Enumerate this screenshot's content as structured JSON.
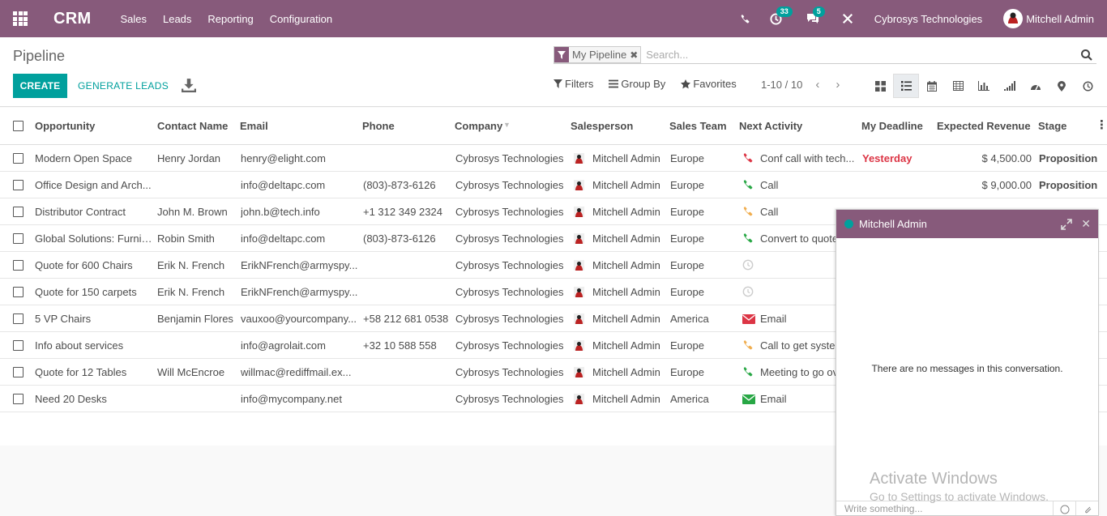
{
  "navbar": {
    "app_name": "CRM",
    "menu": [
      "Sales",
      "Leads",
      "Reporting",
      "Configuration"
    ],
    "activity_count": "33",
    "message_count": "5",
    "company": "Cybrosys Technologies",
    "user": "Mitchell Admin",
    "bg_color": "#875a7b"
  },
  "control_panel": {
    "breadcrumb": "Pipeline",
    "facet": "My Pipeline",
    "search_placeholder": "Search...",
    "create_label": "CREATE",
    "generate_label": "GENERATE LEADS",
    "filters_label": "Filters",
    "groupby_label": "Group By",
    "favorites_label": "Favorites",
    "pager": "1-10 / 10"
  },
  "table": {
    "headers": {
      "opportunity": "Opportunity",
      "contact": "Contact Name",
      "email": "Email",
      "phone": "Phone",
      "company": "Company",
      "salesperson": "Salesperson",
      "team": "Sales Team",
      "activity": "Next Activity",
      "deadline": "My Deadline",
      "revenue": "Expected Revenue",
      "stage": "Stage"
    },
    "rows": [
      {
        "opportunity": "Modern Open Space",
        "contact": "Henry Jordan",
        "email": "henry@elight.com",
        "phone": "",
        "company": "Cybrosys Technologies",
        "salesperson": "Mitchell Admin",
        "team": "Europe",
        "activity": "Conf call with tech...",
        "activity_icon": "phone-red",
        "deadline": "Yesterday",
        "revenue": "$ 4,500.00",
        "stage": "Proposition"
      },
      {
        "opportunity": "Office Design and Arch...",
        "contact": "",
        "email": "info@deltapc.com",
        "phone": "(803)-873-6126",
        "company": "Cybrosys Technologies",
        "salesperson": "Mitchell Admin",
        "team": "Europe",
        "activity": "Call",
        "activity_icon": "phone-green",
        "deadline": "",
        "revenue": "$ 9,000.00",
        "stage": "Proposition"
      },
      {
        "opportunity": "Distributor Contract",
        "contact": "John M. Brown",
        "email": "john.b@tech.info",
        "phone": "+1 312 349 2324",
        "company": "Cybrosys Technologies",
        "salesperson": "Mitchell Admin",
        "team": "Europe",
        "activity": "Call",
        "activity_icon": "phone-orange",
        "deadline": "",
        "revenue": "",
        "stage": ""
      },
      {
        "opportunity": "Global Solutions: Furnit...",
        "contact": "Robin Smith",
        "email": "info@deltapc.com",
        "phone": "(803)-873-6126",
        "company": "Cybrosys Technologies",
        "salesperson": "Mitchell Admin",
        "team": "Europe",
        "activity": "Convert to quote",
        "activity_icon": "phone-green",
        "deadline": "",
        "revenue": "",
        "stage": ""
      },
      {
        "opportunity": "Quote for 600 Chairs",
        "contact": "Erik N. French",
        "email": "ErikNFrench@armyspy...",
        "phone": "",
        "company": "Cybrosys Technologies",
        "salesperson": "Mitchell Admin",
        "team": "Europe",
        "activity": "",
        "activity_icon": "clock-gray",
        "deadline": "",
        "revenue": "",
        "stage": ""
      },
      {
        "opportunity": "Quote for 150 carpets",
        "contact": "Erik N. French",
        "email": "ErikNFrench@armyspy...",
        "phone": "",
        "company": "Cybrosys Technologies",
        "salesperson": "Mitchell Admin",
        "team": "Europe",
        "activity": "",
        "activity_icon": "clock-gray",
        "deadline": "",
        "revenue": "",
        "stage": ""
      },
      {
        "opportunity": "5 VP Chairs",
        "contact": "Benjamin Flores",
        "email": "vauxoo@yourcompany...",
        "phone": "+58 212 681 0538",
        "company": "Cybrosys Technologies",
        "salesperson": "Mitchell Admin",
        "team": "America",
        "activity": "Email",
        "activity_icon": "email-red",
        "deadline": "",
        "revenue": "",
        "stage": ""
      },
      {
        "opportunity": "Info about services",
        "contact": "",
        "email": "info@agrolait.com",
        "phone": "+32 10 588 558",
        "company": "Cybrosys Technologies",
        "salesperson": "Mitchell Admin",
        "team": "Europe",
        "activity": "Call to get system",
        "activity_icon": "phone-orange",
        "deadline": "",
        "revenue": "",
        "stage": ""
      },
      {
        "opportunity": "Quote for 12 Tables",
        "contact": "Will McEncroe",
        "email": "willmac@rediffmail.ex...",
        "phone": "",
        "company": "Cybrosys Technologies",
        "salesperson": "Mitchell Admin",
        "team": "Europe",
        "activity": "Meeting to go over",
        "activity_icon": "phone-green",
        "deadline": "",
        "revenue": "",
        "stage": ""
      },
      {
        "opportunity": "Need 20 Desks",
        "contact": "",
        "email": "info@mycompany.net",
        "phone": "",
        "company": "Cybrosys Technologies",
        "salesperson": "Mitchell Admin",
        "team": "America",
        "activity": "Email",
        "activity_icon": "email-green",
        "deadline": "",
        "revenue": "",
        "stage": ""
      }
    ]
  },
  "chat": {
    "title": "Mitchell Admin",
    "empty_message": "There are no messages in this conversation.",
    "composer_placeholder": "Write something..."
  },
  "watermark": {
    "title": "Activate Windows",
    "subtitle": "Go to Settings to activate Windows."
  },
  "colors": {
    "accent": "#00a09d",
    "overdue": "#dc3545",
    "phone_red": "#dc3545",
    "phone_green": "#28a745",
    "phone_orange": "#f0ad4e",
    "email_red": "#dc3545",
    "email_green": "#28a745"
  }
}
